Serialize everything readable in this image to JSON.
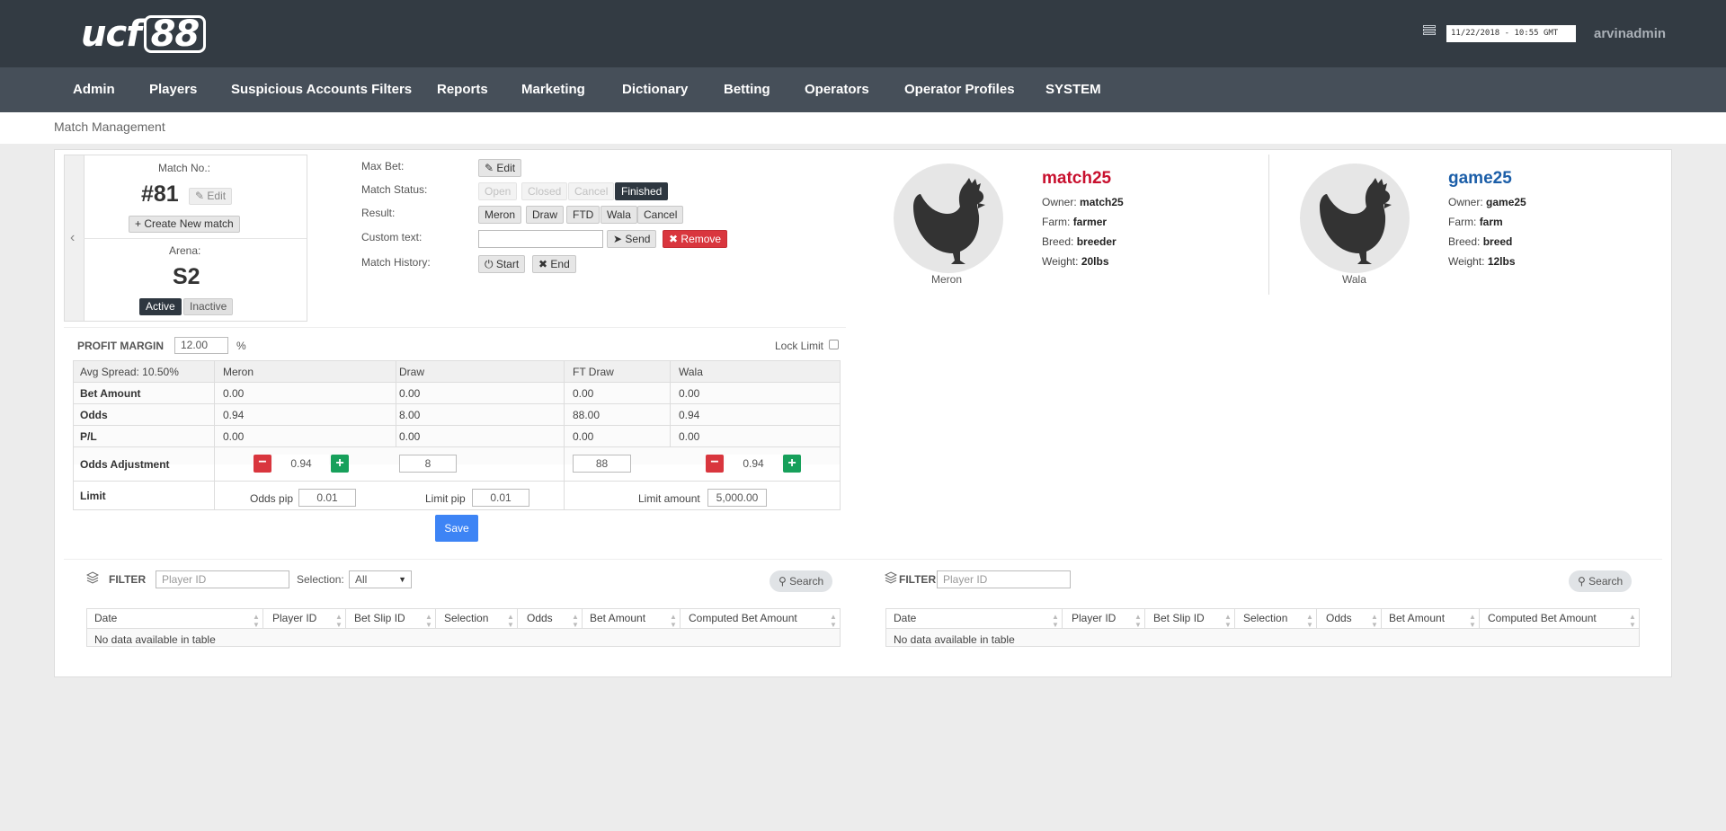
{
  "header": {
    "logo": {
      "text": "ucf",
      "number": "88"
    },
    "datetime": "11/22/2018 - 10:55 GMT",
    "username": "arvinadmin"
  },
  "nav": [
    "Admin",
    "Players",
    "Suspicious Accounts Filters",
    "Reports",
    "Marketing",
    "Dictionary",
    "Betting",
    "Operators",
    "Operator Profiles",
    "SYSTEM"
  ],
  "breadcrumb": "Match Management",
  "match": {
    "label": "Match No.:",
    "number": "#81",
    "edit": "Edit",
    "create": "+ Create New match",
    "arena_label": "Arena:",
    "arena": "S2",
    "active": "Active",
    "inactive": "Inactive"
  },
  "controls": {
    "max_bet_label": "Max Bet:",
    "max_bet_edit": "Edit",
    "status_label": "Match Status:",
    "status_buttons": [
      "Open",
      "Closed",
      "Cancel",
      "Finished"
    ],
    "result_label": "Result:",
    "result_buttons": [
      "Meron",
      "Draw",
      "FTD",
      "Wala",
      "Cancel"
    ],
    "custom_label": "Custom text:",
    "custom_value": "",
    "send": "Send",
    "remove": "Remove",
    "history_label": "Match History:",
    "start": "Start",
    "end": "End"
  },
  "meron": {
    "caption": "Meron",
    "name": "match25",
    "owner_label": "Owner:",
    "owner": "match25",
    "farm_label": "Farm:",
    "farm": "farmer",
    "breed_label": "Breed:",
    "breed": "breeder",
    "weight_label": "Weight:",
    "weight": "20lbs",
    "color": "#c8102e"
  },
  "wala": {
    "caption": "Wala",
    "name": "game25",
    "owner_label": "Owner:",
    "owner": "game25",
    "farm_label": "Farm:",
    "farm": "farm",
    "breed_label": "Breed:",
    "breed": "breed",
    "weight_label": "Weight:",
    "weight": "12lbs",
    "color": "#1b5ea8"
  },
  "profit": {
    "label": "PROFIT MARGIN",
    "value": "12.00",
    "unit": "%",
    "lock_label": "Lock Limit"
  },
  "odds_table": {
    "corner": "Avg Spread: 10.50%",
    "columns": [
      "Meron",
      "Draw",
      "FT Draw",
      "Wala"
    ],
    "rows": [
      {
        "label": "Bet Amount",
        "values": [
          "0.00",
          "0.00",
          "0.00",
          "0.00"
        ]
      },
      {
        "label": "Odds",
        "values": [
          "0.94",
          "8.00",
          "88.00",
          "0.94"
        ]
      },
      {
        "label": "P/L",
        "values": [
          "0.00",
          "0.00",
          "0.00",
          "0.00"
        ]
      }
    ],
    "adjust_label": "Odds Adjustment",
    "adjust_values": [
      "0.94",
      "8",
      "88",
      "0.94"
    ],
    "limit_label": "Limit",
    "odds_pip_label": "Odds pip",
    "odds_pip": "0.01",
    "limit_pip_label": "Limit pip",
    "limit_pip": "0.01",
    "limit_amount_label": "Limit amount",
    "limit_amount": "5,000.00",
    "save": "Save"
  },
  "filter_left": {
    "label": "FILTER",
    "placeholder": "Player ID",
    "selection_label": "Selection:",
    "selection_value": "All",
    "search": "Search"
  },
  "filter_right": {
    "label": "FILTER",
    "placeholder": "Player ID",
    "search": "Search"
  },
  "grid": {
    "columns": [
      "Date",
      "Player ID",
      "Bet Slip ID",
      "Selection",
      "Odds",
      "Bet Amount",
      "Computed Bet Amount"
    ],
    "empty": "No data available in table"
  }
}
